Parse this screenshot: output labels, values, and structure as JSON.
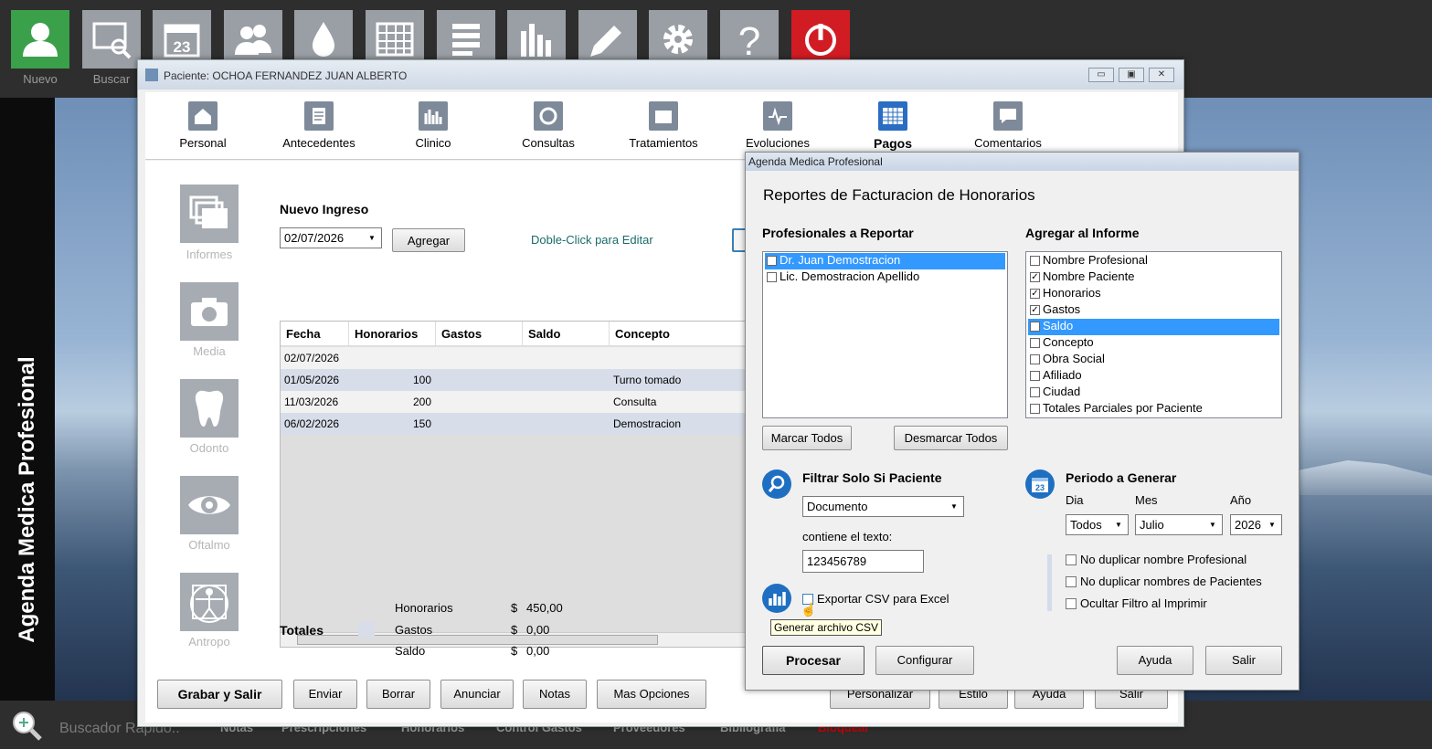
{
  "topbar": {
    "items": [
      {
        "label": "Nuevo",
        "icon": "user-icon"
      },
      {
        "label": "Buscar",
        "icon": "search-screen-icon"
      },
      {
        "label": "",
        "icon": "calendar-icon",
        "text": "23"
      },
      {
        "label": "",
        "icon": "group-icon"
      },
      {
        "label": "",
        "icon": "drop-icon"
      },
      {
        "label": "",
        "icon": "grid-icon"
      },
      {
        "label": "",
        "icon": "list-edit-icon"
      },
      {
        "label": "",
        "icon": "bar-chart-icon"
      },
      {
        "label": "",
        "icon": "pen-icon"
      },
      {
        "label": "",
        "icon": "gear-icon"
      },
      {
        "label": "",
        "icon": "help-icon",
        "text": "?"
      },
      {
        "label": "",
        "icon": "power-icon"
      }
    ]
  },
  "brand": "Agenda Medica Profesional",
  "bottombar": {
    "search_placeholder": "Buscador Rapido..",
    "items": [
      "Notas",
      "Prescripciones",
      "Honorarios",
      "Control Gastos",
      "Proveedores",
      "Bibliografia",
      "Bloquear"
    ],
    "accent_color": "#cc0000"
  },
  "window": {
    "title": "Paciente: OCHOA FERNANDEZ JUAN ALBERTO",
    "ctrl": {
      "min": "▭",
      "max": "▣",
      "close": "✕"
    },
    "tabs": [
      {
        "label": "Personal"
      },
      {
        "label": "Antecedentes"
      },
      {
        "label": "Clinico"
      },
      {
        "label": "Consultas"
      },
      {
        "label": "Tratamientos"
      },
      {
        "label": "Evoluciones"
      },
      {
        "label": "Pagos",
        "active": true
      },
      {
        "label": "Comentarios"
      }
    ],
    "side": [
      "Informes",
      "Media",
      "Odonto",
      "Oftalmo",
      "Antropo"
    ],
    "nuevo_ingreso": "Nuevo Ingreso",
    "date_value": "02/07/2026",
    "agregar": "Agregar",
    "doble_click": "Doble-Click para Editar",
    "grid": {
      "headers": [
        "Fecha",
        "Honorarios",
        "Gastos",
        "Saldo",
        "Concepto"
      ],
      "rows": [
        {
          "fecha": "02/07/2026",
          "honorarios": "",
          "gastos": "",
          "saldo": "",
          "concepto": ""
        },
        {
          "fecha": "01/05/2026",
          "honorarios": "100",
          "gastos": "",
          "saldo": "",
          "concepto": "Turno tomado"
        },
        {
          "fecha": "11/03/2026",
          "honorarios": "200",
          "gastos": "",
          "saldo": "",
          "concepto": "Consulta"
        },
        {
          "fecha": "06/02/2026",
          "honorarios": "150",
          "gastos": "",
          "saldo": "",
          "concepto": "Demostracion"
        }
      ]
    },
    "totales": {
      "label": "Totales",
      "rows": [
        {
          "name": "Honorarios",
          "cur": "$",
          "value": "450,00"
        },
        {
          "name": "Gastos",
          "cur": "$",
          "value": "0,00"
        },
        {
          "name": "Saldo",
          "cur": "$",
          "value": "0,00"
        }
      ]
    },
    "buttons": [
      "Grabar y Salir",
      "Enviar",
      "Borrar",
      "Anunciar",
      "Notas",
      "Mas Opciones"
    ],
    "right_buttons": [
      "Personalizar",
      "Estilo",
      "Ayuda",
      "Salir"
    ]
  },
  "dialog": {
    "title": "Agenda Medica Profesional",
    "heading": "Reportes de Facturacion de Honorarios",
    "prof_label": "Profesionales a Reportar",
    "profesionales": [
      {
        "name": "Dr. Juan Demostracion",
        "checked": true,
        "selected": true
      },
      {
        "name": "Lic. Demostracion Apellido",
        "checked": false,
        "selected": false
      }
    ],
    "agregar_label": "Agregar al Informe",
    "informe_items": [
      {
        "name": "Nombre Profesional",
        "checked": false,
        "selected": false
      },
      {
        "name": "Nombre Paciente",
        "checked": true,
        "selected": false
      },
      {
        "name": "Honorarios",
        "checked": true,
        "selected": false
      },
      {
        "name": "Gastos",
        "checked": true,
        "selected": false
      },
      {
        "name": "Saldo",
        "checked": true,
        "selected": true
      },
      {
        "name": "Concepto",
        "checked": false,
        "selected": false
      },
      {
        "name": "Obra Social",
        "checked": false,
        "selected": false
      },
      {
        "name": "Afiliado",
        "checked": false,
        "selected": false
      },
      {
        "name": "Ciudad",
        "checked": false,
        "selected": false
      },
      {
        "name": "Totales Parciales por Paciente",
        "checked": false,
        "selected": false
      }
    ],
    "marcar": "Marcar Todos",
    "desmarcar": "Desmarcar Todos",
    "filtrar_label": "Filtrar Solo Si Paciente",
    "filtro_combo": "Documento",
    "contiene": "contiene el texto:",
    "texto_value": "123456789",
    "exportar": "Exportar CSV para Excel",
    "tooltip": "Generar archivo CSV",
    "periodo_label": "Periodo a Generar",
    "dia_label": "Dia",
    "mes_label": "Mes",
    "anio_label": "Año",
    "dia_value": "Todos",
    "mes_value": "Julio",
    "anio_value": "2026",
    "cal_num": "23",
    "options": [
      {
        "name": "No duplicar nombre Profesional",
        "checked": false
      },
      {
        "name": "No duplicar nombres de Pacientes",
        "checked": false
      },
      {
        "name": "Ocultar Filtro al Imprimir",
        "checked": false
      }
    ],
    "procesar": "Procesar",
    "configurar": "Configurar",
    "ayuda": "Ayuda",
    "salir": "Salir"
  }
}
